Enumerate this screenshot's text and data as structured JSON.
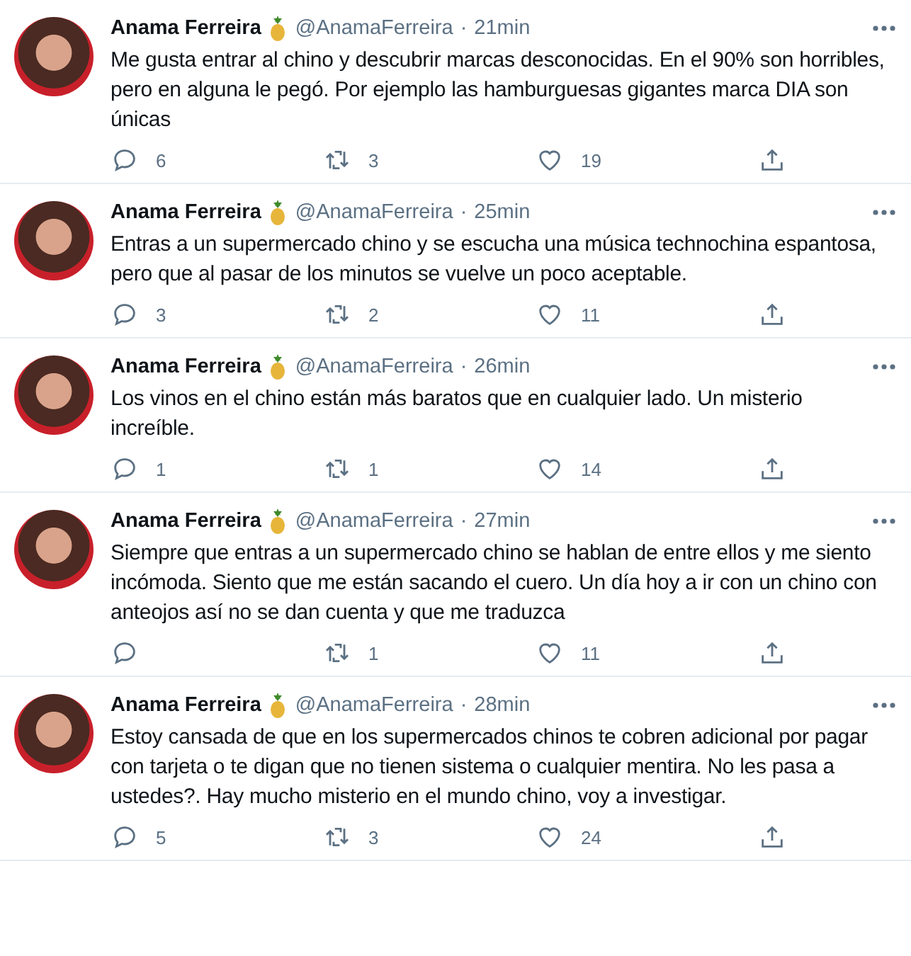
{
  "tweets": [
    {
      "name": "Anama Ferreira",
      "handle": "@AnamaFerreira",
      "separator": "·",
      "time": "21min",
      "text": "Me gusta entrar al chino y descubrir marcas desconocidas. En el 90% son horribles, pero en alguna le pegó. Por ejemplo las hamburguesas gigantes marca DIA son únicas",
      "replies": "6",
      "retweets": "3",
      "likes": "19"
    },
    {
      "name": "Anama Ferreira",
      "handle": "@AnamaFerreira",
      "separator": "·",
      "time": "25min",
      "text": "Entras a un supermercado chino y se escucha una música technochina espantosa, pero que al pasar de los minutos se vuelve un poco aceptable.",
      "replies": "3",
      "retweets": "2",
      "likes": "11"
    },
    {
      "name": "Anama Ferreira",
      "handle": "@AnamaFerreira",
      "separator": "·",
      "time": "26min",
      "text": "Los vinos en el chino están más baratos que en cualquier lado. Un misterio increíble.",
      "replies": "1",
      "retweets": "1",
      "likes": "14"
    },
    {
      "name": "Anama Ferreira",
      "handle": "@AnamaFerreira",
      "separator": "·",
      "time": "27min",
      "text": "Siempre que entras a un supermercado chino se hablan de entre ellos y me siento incómoda. Siento que me están sacando el cuero. Un día hoy a ir con un chino con anteojos así no se dan cuenta y que me traduzca",
      "retweets": "1",
      "likes": "11"
    },
    {
      "name": "Anama Ferreira",
      "handle": "@AnamaFerreira",
      "separator": "·",
      "time": "28min",
      "text": "Estoy cansada de que en los supermercados chinos te cobren adicional por pagar con tarjeta o te digan que no tienen sistema o cualquier mentira. No les pasa a ustedes?. Hay mucho misterio en el mundo chino, voy a investigar.",
      "replies": "5",
      "retweets": "3",
      "likes": "24"
    }
  ]
}
